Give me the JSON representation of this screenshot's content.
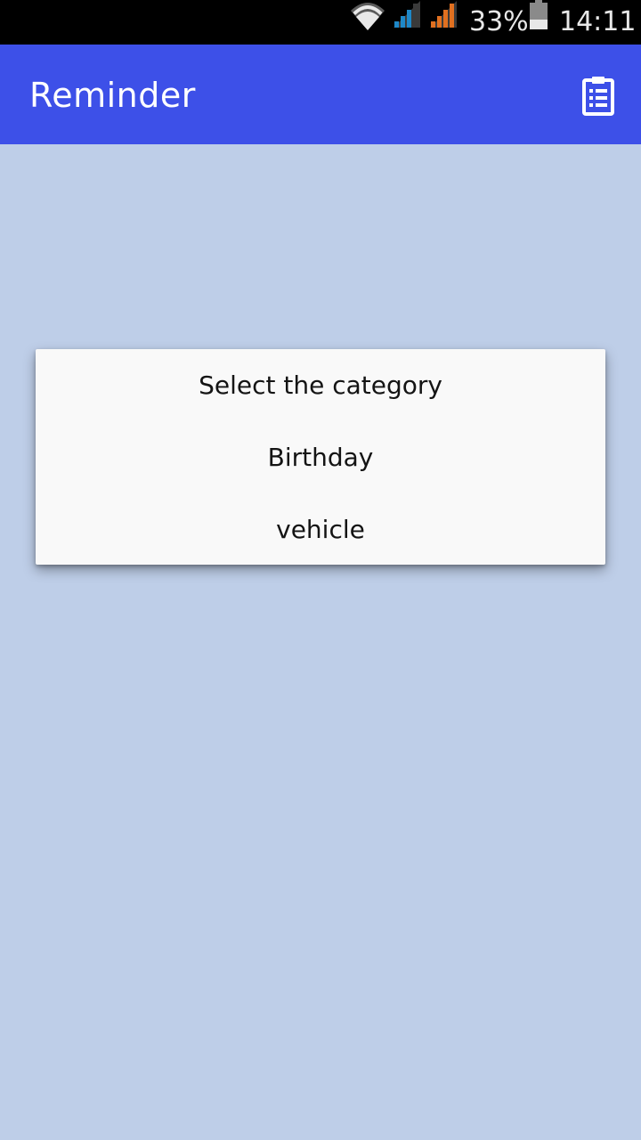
{
  "status_bar": {
    "battery_percent": "33%",
    "time": "14:11",
    "icons": [
      "wifi-icon",
      "signal-icon",
      "signal-icon",
      "battery-icon"
    ],
    "signal_colors": [
      "#1E88C8",
      "#E07020"
    ]
  },
  "app_bar": {
    "title": "Reminder",
    "action_icon": "clipboard-list-icon",
    "color": "#3D50E8"
  },
  "dialog": {
    "title": "Select the category",
    "options": [
      "Birthday",
      "vehicle"
    ]
  },
  "colors": {
    "background": "#BECEE8",
    "dialog_bg": "#F9F9F9"
  }
}
